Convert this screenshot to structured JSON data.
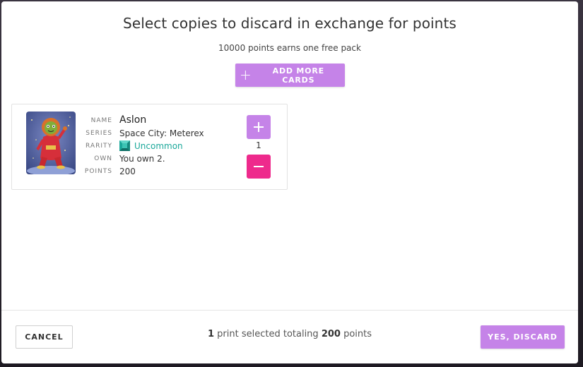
{
  "modal": {
    "title": "Select copies to discard in exchange for points",
    "subtitle": "10000 points earns one free pack",
    "add_more_label": "ADD MORE CARDS"
  },
  "card": {
    "labels": {
      "name": "NAME",
      "series": "SERIES",
      "rarity": "RARITY",
      "own": "OWN",
      "points": "POINTS"
    },
    "name": "Aslon",
    "series": "Space City: Meterex",
    "rarity": "Uncommon",
    "own": "You own 2.",
    "points": "200",
    "selected_count": "1",
    "rarity_color": "#1aa89a"
  },
  "footer": {
    "cancel_label": "CANCEL",
    "summary_count": "1",
    "summary_middle": " print selected totaling ",
    "summary_points": "200",
    "summary_suffix": " points",
    "confirm_label": "YES, DISCARD"
  },
  "colors": {
    "accent_purple": "#c583e8",
    "accent_pink": "#ee2a8c",
    "rarity_teal": "#1aa89a"
  },
  "icons": [
    "plus-icon",
    "minus-icon",
    "uncommon-gem-icon"
  ]
}
